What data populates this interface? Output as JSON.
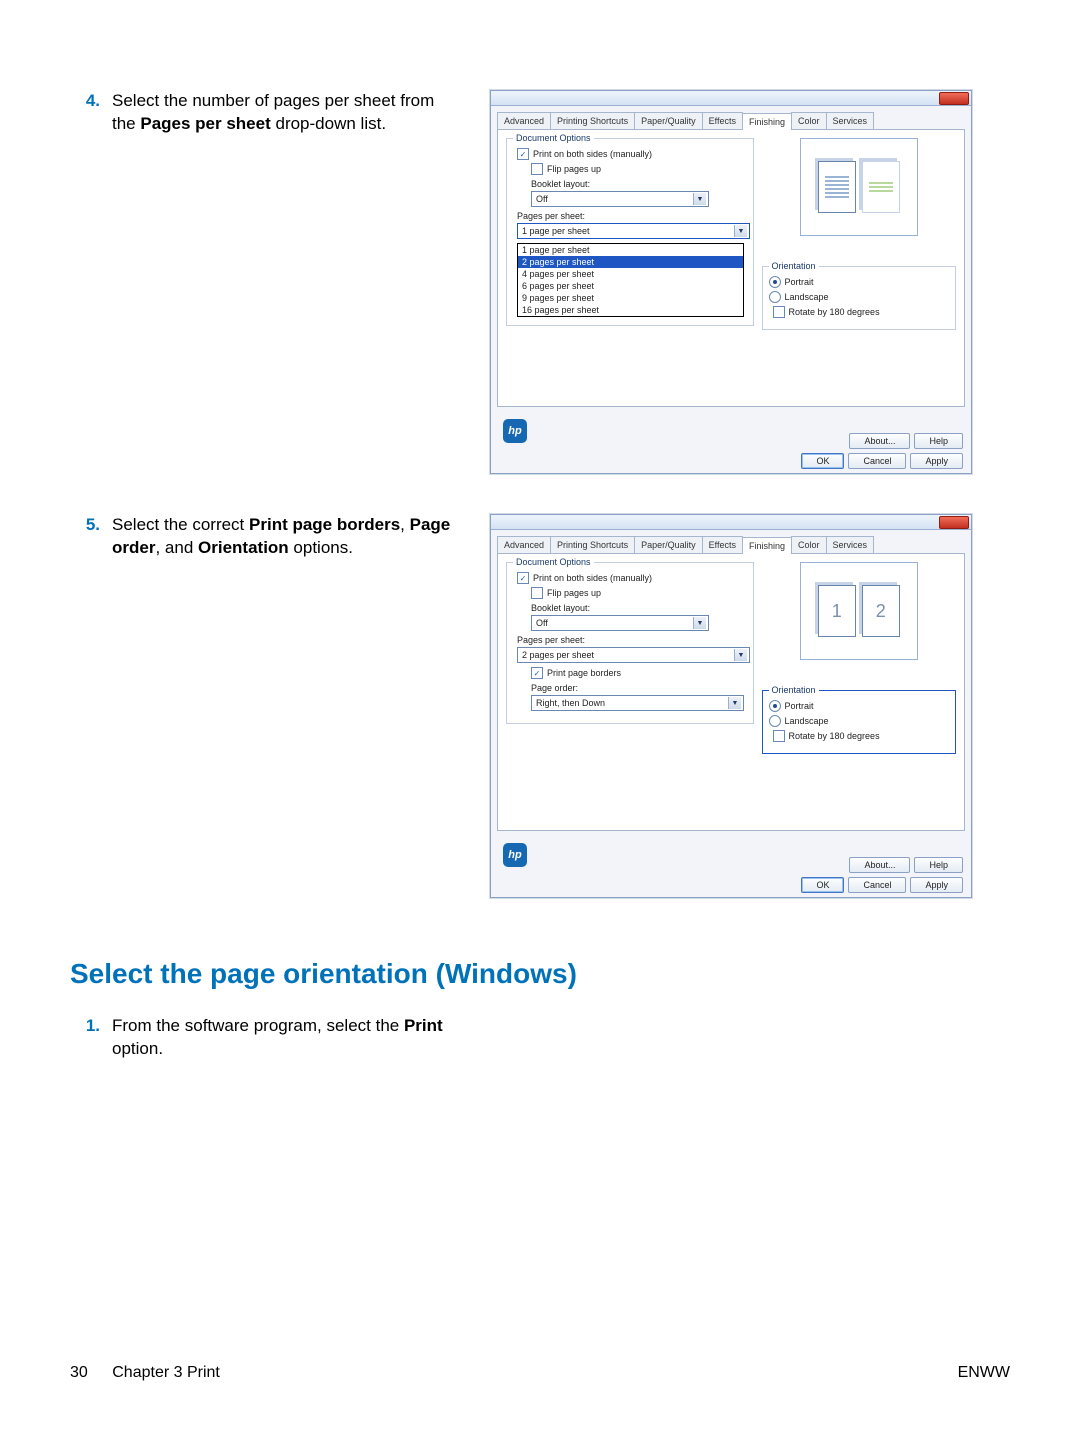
{
  "steps_a": {
    "num4": "4.",
    "txt4_a": "Select the number of pages per sheet from the ",
    "txt4_b": "Pages per sheet",
    "txt4_c": " drop-down list.",
    "num5": "5.",
    "txt5_a": "Select the correct ",
    "txt5_b": "Print page borders",
    "txt5_c": ", ",
    "txt5_d": "Page order",
    "txt5_e": ", and ",
    "txt5_f": "Orientation",
    "txt5_g": " options."
  },
  "section_heading": "Select the page orientation (Windows)",
  "steps_b": {
    "num1": "1.",
    "txt1_a": "From the software program, select the ",
    "txt1_b": "Print",
    "txt1_c": " option."
  },
  "dialog": {
    "tabs": [
      "Advanced",
      "Printing Shortcuts",
      "Paper/Quality",
      "Effects",
      "Finishing",
      "Color",
      "Services"
    ],
    "active_tab": "Finishing",
    "doc_options_legend": "Document Options",
    "print_both": "Print on both sides (manually)",
    "flip": "Flip pages up",
    "booklet_lbl": "Booklet layout:",
    "booklet_val": "Off",
    "pps_lbl": "Pages per sheet:",
    "pps_selected_1": "1 page per sheet",
    "pps_options": [
      "1 page per sheet",
      "2 pages per sheet",
      "4 pages per sheet",
      "6 pages per sheet",
      "9 pages per sheet",
      "16 pages per sheet"
    ],
    "pps_highlight_index": 1,
    "pps_selected_2": "2 pages per sheet",
    "borders": "Print page borders",
    "order_lbl": "Page order:",
    "order_val": "Right, then Down",
    "orientation_legend": "Orientation",
    "portrait": "Portrait",
    "landscape": "Landscape",
    "rotate": "Rotate by 180 degrees",
    "btn_about": "About...",
    "btn_help": "Help",
    "btn_ok": "OK",
    "btn_cancel": "Cancel",
    "btn_apply": "Apply",
    "preview_num1": "1",
    "preview_num2": "2"
  },
  "footer": {
    "page_num": "30",
    "chapter": "Chapter 3   Print",
    "right": "ENWW"
  }
}
